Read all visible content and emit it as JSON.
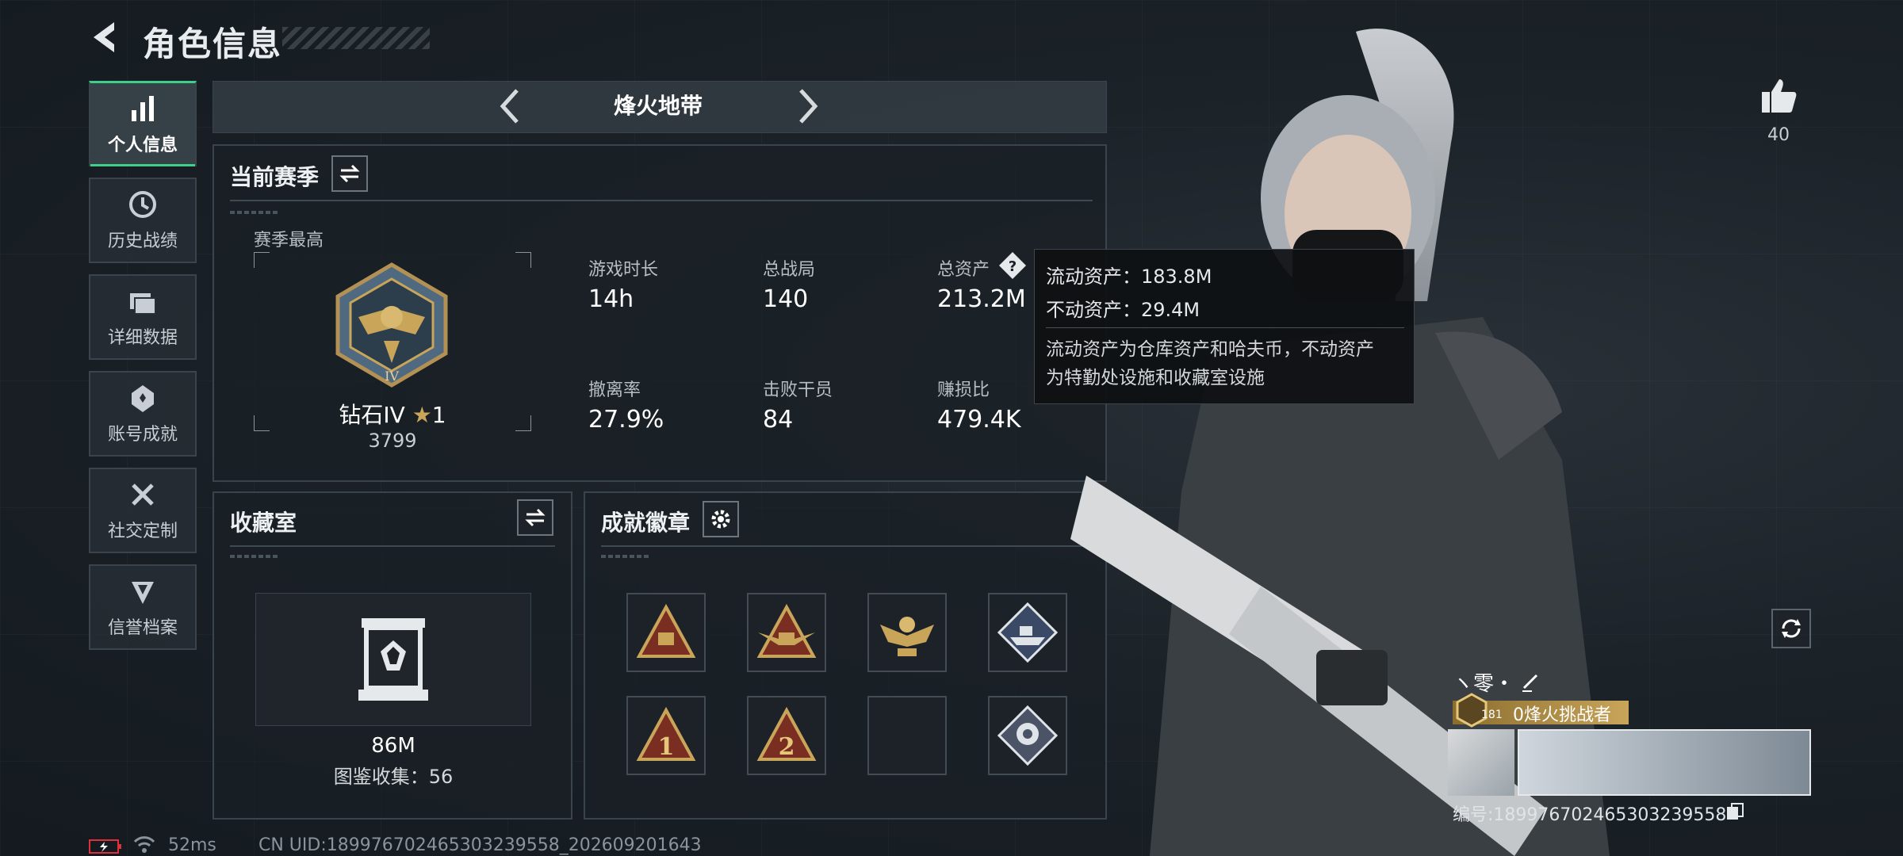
{
  "header": {
    "title": "角色信息"
  },
  "sidebar": {
    "items": [
      {
        "label": "个人信息",
        "icon": "bar-chart-icon",
        "active": true
      },
      {
        "label": "历史战绩",
        "icon": "clock-icon",
        "active": false
      },
      {
        "label": "详细数据",
        "icon": "folder-icon",
        "active": false
      },
      {
        "label": "账号成就",
        "icon": "achievement-icon",
        "active": false
      },
      {
        "label": "社交定制",
        "icon": "tools-icon",
        "active": false
      },
      {
        "label": "信誉档案",
        "icon": "shield-icon",
        "active": false
      }
    ]
  },
  "mode": {
    "title": "烽火地带"
  },
  "season": {
    "title": "当前赛季",
    "best_label": "赛季最高",
    "rank_name": "钻石IV",
    "rank_stars": "1",
    "rank_points": "3799",
    "stats": [
      {
        "label": "游戏时长",
        "value": "14h"
      },
      {
        "label": "总战局",
        "value": "140"
      },
      {
        "label": "总资产",
        "value": "213.2M"
      },
      {
        "label": "撤离率",
        "value": "27.9%"
      },
      {
        "label": "击败干员",
        "value": "84"
      },
      {
        "label": "赚损比",
        "value": "479.4K"
      }
    ]
  },
  "tooltip": {
    "liquid": "流动资产：183.8M",
    "fixed": "不动资产：29.4M",
    "note_line1": "流动资产为仓库资产和哈夫币，不动资产",
    "note_line2": "为特勤处设施和收藏室设施"
  },
  "collection": {
    "title": "收藏室",
    "value": "86M",
    "catalog": "图鉴收集：56"
  },
  "badges": {
    "title": "成就徽章",
    "items": [
      "badge-s8-icon",
      "badge-s8-wings-icon",
      "badge-eagle-icon",
      "badge-ship-icon",
      "badge-one-icon",
      "badge-two-icon",
      "empty",
      "badge-rose-icon"
    ]
  },
  "likes": {
    "count": "40"
  },
  "profile": {
    "name": "ヽ零・",
    "level": "181",
    "title": "0烽火挑战者",
    "id_text": "编号:18997670246530323955​8"
  },
  "status": {
    "ping": "52ms",
    "uid": "CN UID:18997670246530323955​8_202609201643"
  },
  "colors": {
    "accent_green": "#3ed089",
    "gold": "#c9a55a"
  }
}
